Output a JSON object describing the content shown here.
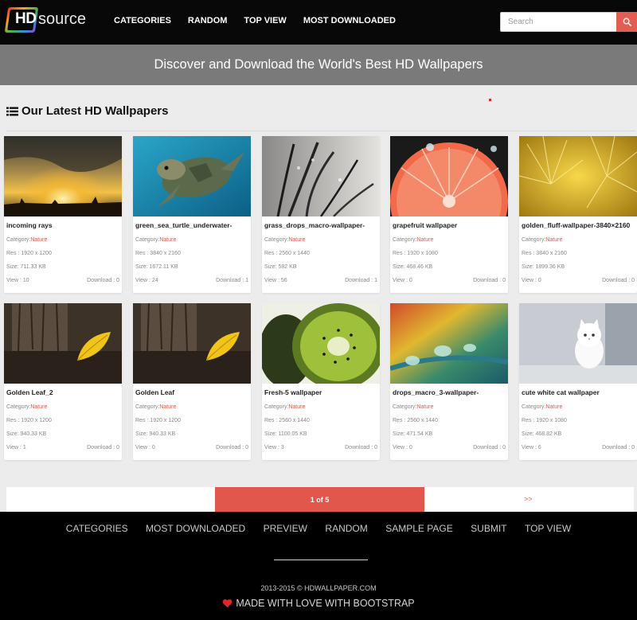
{
  "brand": {
    "hd": "HD",
    "source": "source"
  },
  "nav": {
    "items": [
      "CATEGORIES",
      "RANDOM",
      "TOP VIEW",
      "MOST DOWNLOADED"
    ]
  },
  "search": {
    "placeholder": "Search",
    "icon": "search-icon"
  },
  "banner": {
    "text": "Discover and Download the World's Best HD Wallpapers"
  },
  "section": {
    "title": "Our Latest HD Wallpapers",
    "icon": "list-icon"
  },
  "labels": {
    "category": "Category:",
    "res": "Res : ",
    "size": "Size: ",
    "view": "View : ",
    "download": "Download : "
  },
  "cards": [
    {
      "title": "incoming rays",
      "category": "Nature",
      "res": "1920 x 1200",
      "size": "711.33 KB",
      "views": "10",
      "downloads": "0"
    },
    {
      "title": "green_sea_turtle_underwater-",
      "category": "Nature",
      "res": "3840 x 2160",
      "size": "1672.11 KB",
      "views": "24",
      "downloads": "1"
    },
    {
      "title": "grass_drops_macro-wallpaper-",
      "category": "Nature",
      "res": "2560 x 1440",
      "size": "582 KB",
      "views": "56",
      "downloads": "1"
    },
    {
      "title": "grapefruit wallpaper",
      "category": "Nature",
      "res": "1920 x 1080",
      "size": "468.46 KB",
      "views": "0",
      "downloads": "0"
    },
    {
      "title": "golden_fluff-wallpaper-3840×2160",
      "category": "Nature",
      "res": "3840 x 2160",
      "size": "1899.36 KB",
      "views": "0",
      "downloads": "0"
    },
    {
      "title": "Golden Leaf_2",
      "category": "Nature",
      "res": "1920 x 1200",
      "size": "940.33 KB",
      "views": "1",
      "downloads": "0"
    },
    {
      "title": "Golden Leaf",
      "category": "Nature",
      "res": "1920 x 1200",
      "size": "940.33 KB",
      "views": "0",
      "downloads": "0"
    },
    {
      "title": "Fresh-5 wallpaper",
      "category": "Nature",
      "res": "2560 x 1440",
      "size": "1100.05 KB",
      "views": "3",
      "downloads": "0"
    },
    {
      "title": "drops_macro_3-wallpaper-",
      "category": "Nature",
      "res": "2560 x 1440",
      "size": "471.54 KB",
      "views": "0",
      "downloads": "0"
    },
    {
      "title": "cute white cat wallpaper",
      "category": "Nature",
      "res": "1920 x 1080",
      "size": "468.82 KB",
      "views": "6",
      "downloads": "0"
    }
  ],
  "pagination": {
    "current": "1 of 5",
    "next": ">>"
  },
  "footer": {
    "links": [
      "CATEGORIES",
      "MOST DOWNLOADED",
      "PREVIEW",
      "RANDOM",
      "SAMPLE PAGE",
      "SUBMIT",
      "TOP VIEW"
    ],
    "copyright": "2013-2015 © HDWALLPAPER.COM",
    "made": "MADE WITH LOVE WITH BOOTSTRAP"
  },
  "colors": {
    "accent": "#e2574c",
    "navbar": "#080808",
    "banner": "#7a7a7a",
    "background": "#ececec"
  }
}
